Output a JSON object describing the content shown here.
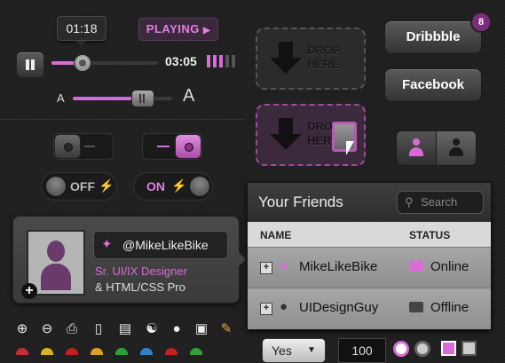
{
  "player": {
    "time_tooltip": "01:18",
    "status": "PLAYING",
    "duration": "03:05",
    "progress": 0.42
  },
  "font_size_slider": {
    "small_label": "A",
    "large_label": "A",
    "value": 0.65
  },
  "toggles": {
    "off_label": "OFF",
    "on_label": "ON"
  },
  "drop_zones": [
    {
      "text1": "DROP",
      "text2": "HERE"
    },
    {
      "text1": "DROP",
      "text2": "HERE"
    }
  ],
  "social": {
    "dribbble_label": "Dribbble",
    "dribbble_count": "8",
    "facebook_label": "Facebook"
  },
  "profile": {
    "twitter_handle": "@MikeLikeBike",
    "title_line1": "Sr. UI/IX Designer",
    "title_line2": "& HTML/CSS Pro"
  },
  "friends": {
    "title": "Your Friends",
    "search_placeholder": "Search",
    "col_name": "NAME",
    "col_status": "STATUS",
    "rows": [
      {
        "name": "MikeLikeBike",
        "status": "Online"
      },
      {
        "name": "UIDesignGuy",
        "status": "Offline"
      }
    ]
  },
  "bottom": {
    "select_value": "Yes",
    "number_value": "100"
  },
  "colors": {
    "accent": "#d96bd9",
    "background": "#1e1e1e"
  },
  "icons": [
    "zoom-in-icon",
    "zoom-out-icon",
    "print-icon",
    "mouse-icon",
    "clipboard-icon",
    "sitemap-icon",
    "lightbulb-icon",
    "chat-icon",
    "pencil-icon"
  ]
}
